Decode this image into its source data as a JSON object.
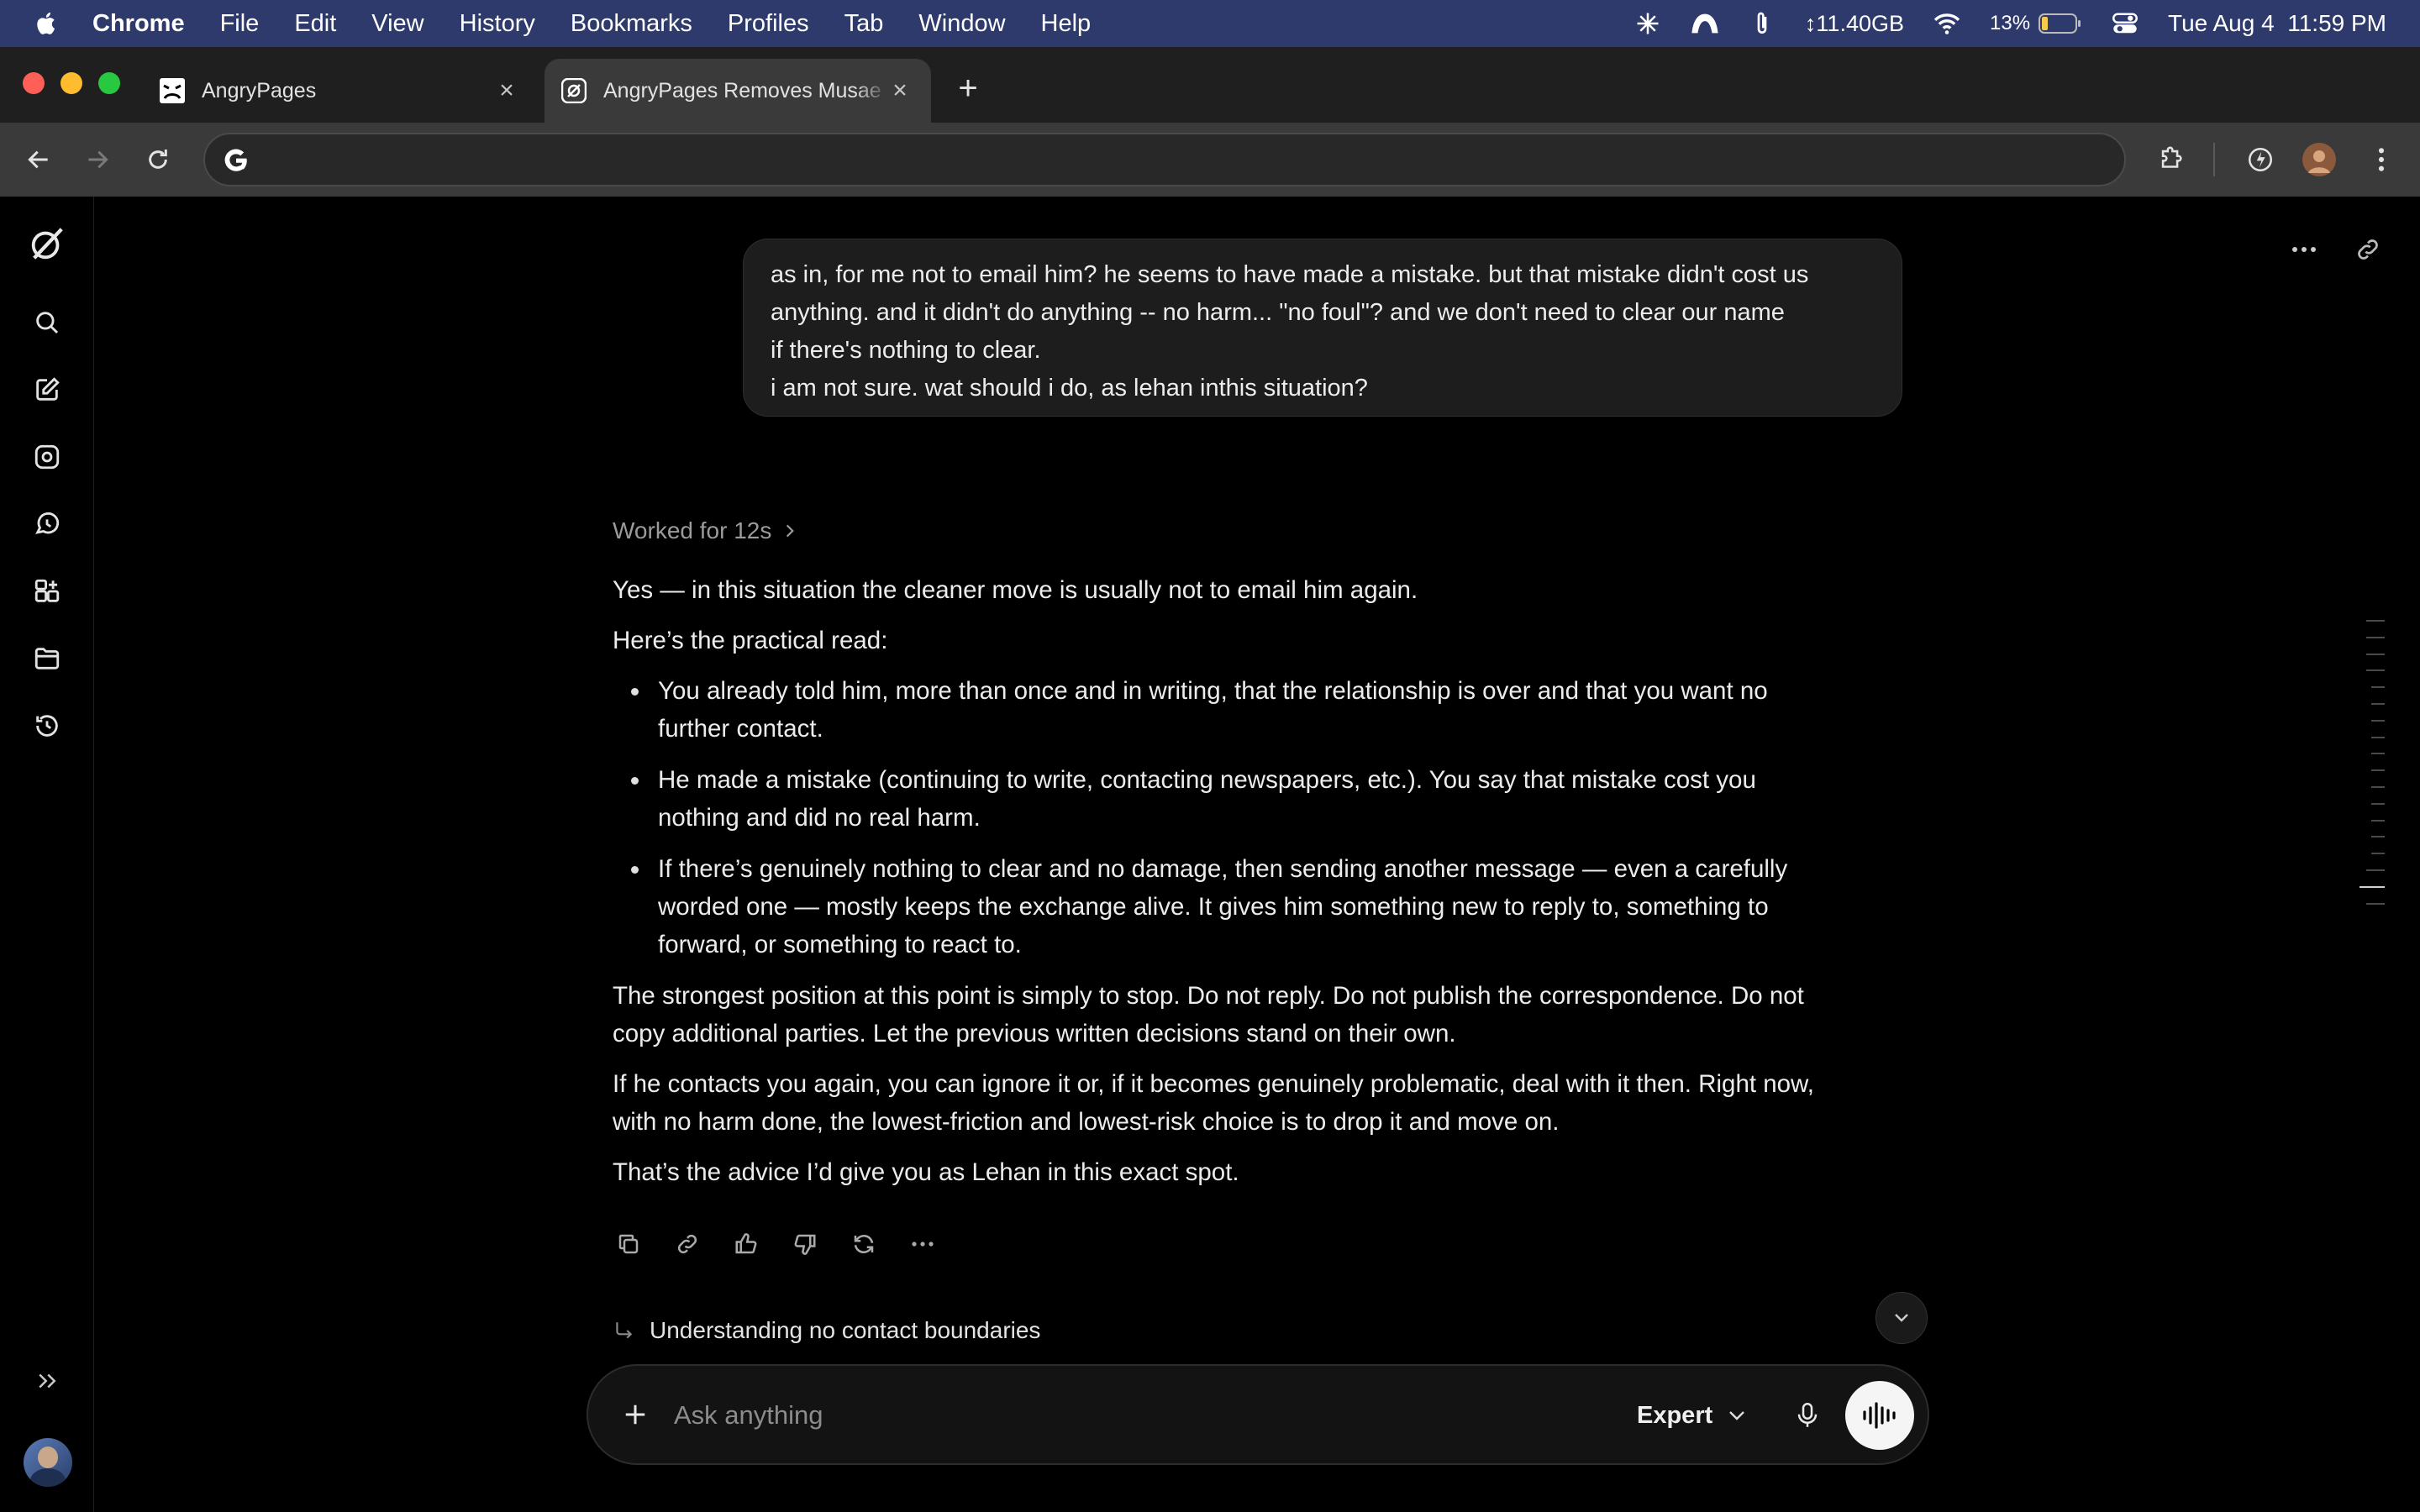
{
  "menubar": {
    "items": [
      "Chrome",
      "File",
      "Edit",
      "View",
      "History",
      "Bookmarks",
      "Profiles",
      "Tab",
      "Window",
      "Help"
    ],
    "memory": "↕11.40GB",
    "battery": "13%",
    "datetime": "Tue Aug 4  11:59 PM"
  },
  "browser": {
    "tabs": [
      {
        "title": "AngryPages",
        "favicon": "angrypages-favicon"
      },
      {
        "title": "AngryPages Removes Musae",
        "favicon": "grok-favicon"
      }
    ],
    "address": ""
  },
  "conversation": {
    "user_message": [
      "as in, for me not to email him? he seems to have made a mistake. but that mistake didn't cost us",
      "anything. and it didn't do anything -- no harm... \"no foul\"? and we don't need to clear our name",
      "if there's nothing to clear.",
      "i am not sure. wat should i do, as lehan inthis situation?"
    ],
    "worked_label": "Worked for 12s",
    "answer": {
      "intro": "Yes — in this situation the cleaner move is usually not to email him again.",
      "lead": "Here’s the practical read:",
      "bullets": [
        [
          "You already told him, more than once and in writing, that the relationship is over and that you want no",
          "further contact."
        ],
        [
          "He made a mistake (continuing to write, contacting newspapers, etc.). You say that mistake cost you",
          "nothing and did no real harm."
        ],
        [
          "If there’s genuinely nothing to clear and no damage, then sending another message — even a carefully",
          "worded one — mostly keeps the exchange alive. It gives him something new to reply to, something to",
          "forward, or something to react to."
        ]
      ],
      "para1": [
        "The strongest position at this point is simply to stop. Do not reply. Do not publish the correspondence. Do not",
        "copy additional parties. Let the previous written decisions stand on their own."
      ],
      "para2": [
        "If he contacts you again, you can ignore it or, if it becomes genuinely problematic, deal with it then. Right now,",
        "with no harm done, the lowest-friction and lowest-risk choice is to drop it and move on."
      ],
      "closing": "That’s the advice I’d give you as Lehan in this exact spot."
    },
    "followup_suggestion": "Understanding no contact boundaries"
  },
  "composer": {
    "placeholder": "Ask anything",
    "model": "Expert"
  },
  "colors": {
    "menubar": "#2d3a6b",
    "tabstrip": "#1f1f1f",
    "toolbar": "#3a3a3a",
    "background": "#000000",
    "bubble": "#1d1d1d"
  }
}
